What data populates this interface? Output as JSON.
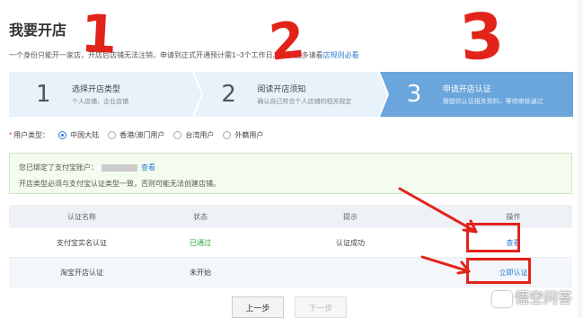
{
  "page": {
    "title": "我要开店",
    "notice": "一个身份只能开一家店，开店后店铺无法注销，申请到正式开通预计需1~3个工作日。了解更多请看",
    "rules_link": "店规则必看"
  },
  "steps": [
    {
      "num": "1",
      "title": "选择开店类型",
      "desc": "个人店铺，企业店铺",
      "active": false
    },
    {
      "num": "2",
      "title": "阅读开店须知",
      "desc": "确认自己符合个人店铺的相关规定",
      "active": false
    },
    {
      "num": "3",
      "title": "申请开店认证",
      "desc": "需提供认证相关资料，等待审核通过",
      "active": true
    }
  ],
  "user_type": {
    "required_mark": "*",
    "label": "用户类型：",
    "options": [
      {
        "label": "中国大陆",
        "selected": true
      },
      {
        "label": "香港/澳门用户",
        "selected": false
      },
      {
        "label": "台湾用户",
        "selected": false
      },
      {
        "label": "外籍用户",
        "selected": false
      }
    ]
  },
  "info": {
    "bound_text": "您已绑定了支付宝账户：",
    "view_link": "查看",
    "warning": "开店类型必须与支付宝认证类型一致，否则可能无法创建店铺。"
  },
  "table": {
    "headers": [
      "认证名称",
      "状态",
      "提示",
      "操作"
    ],
    "rows": [
      {
        "name": "支付宝实名认证",
        "status": "已通过",
        "hint": "认证成功",
        "action": "查看"
      },
      {
        "name": "淘宝开店认证",
        "status": "未开始",
        "hint": "",
        "action": "立即认证"
      }
    ]
  },
  "buttons": {
    "prev": "上一步",
    "next": "下一步"
  },
  "annotations": {
    "mark1": "1",
    "mark2": "2",
    "mark3": "3",
    "color": "#e2231a"
  },
  "watermark": {
    "text": "悟空问答"
  },
  "colors": {
    "accent": "#2b7bd6",
    "active_step": "#6aa6dc",
    "success": "#2fa63a"
  }
}
